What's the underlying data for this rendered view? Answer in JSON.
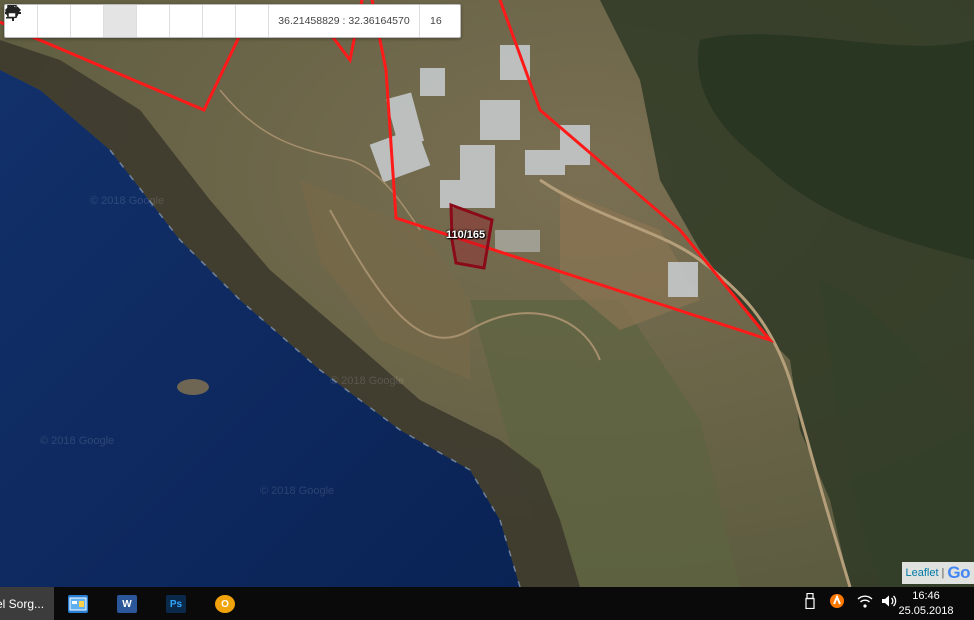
{
  "toolbar": {
    "buttons": [
      {
        "name": "zoom-in-button",
        "icon": "plus-icon",
        "tooltip": ""
      },
      {
        "name": "zoom-out-button",
        "icon": "minus-icon",
        "tooltip": ""
      },
      {
        "name": "refresh-button",
        "icon": "refresh-icon",
        "tooltip": ""
      },
      {
        "name": "locate-button",
        "icon": "crosshair-icon",
        "tooltip": ""
      },
      {
        "name": "info-button",
        "icon": "info-icon",
        "tooltip": ""
      },
      {
        "name": "favorite-button",
        "icon": "star-icon",
        "tooltip": ""
      },
      {
        "name": "measure-button",
        "icon": "arrows-horizontal-icon",
        "tooltip": ""
      },
      {
        "name": "print-button",
        "icon": "printer-icon",
        "tooltip": ""
      }
    ],
    "coordinates": "36.21458829 : 32.36164570",
    "zoom_level": "16"
  },
  "map": {
    "parcel_label": "110/165",
    "parcel_color": "#8b0a1a",
    "boundary_color": "#ff1a1a",
    "sea_color": "#0c2a5c",
    "watermark": "© 2018 Google"
  },
  "attribution": {
    "leaflet_link": "Leaflet",
    "separator": "|",
    "logo_text": "Go"
  },
  "taskbar": {
    "active_window_label": "el Sorg...",
    "apps": [
      {
        "name": "app-icon-control-panel",
        "label": ""
      },
      {
        "name": "app-icon-word",
        "label": "W"
      },
      {
        "name": "app-icon-photoshop",
        "label": "Ps"
      },
      {
        "name": "app-icon-outlook",
        "label": "O"
      }
    ],
    "clock_time": "16:46",
    "clock_date": "25.05.2018"
  }
}
